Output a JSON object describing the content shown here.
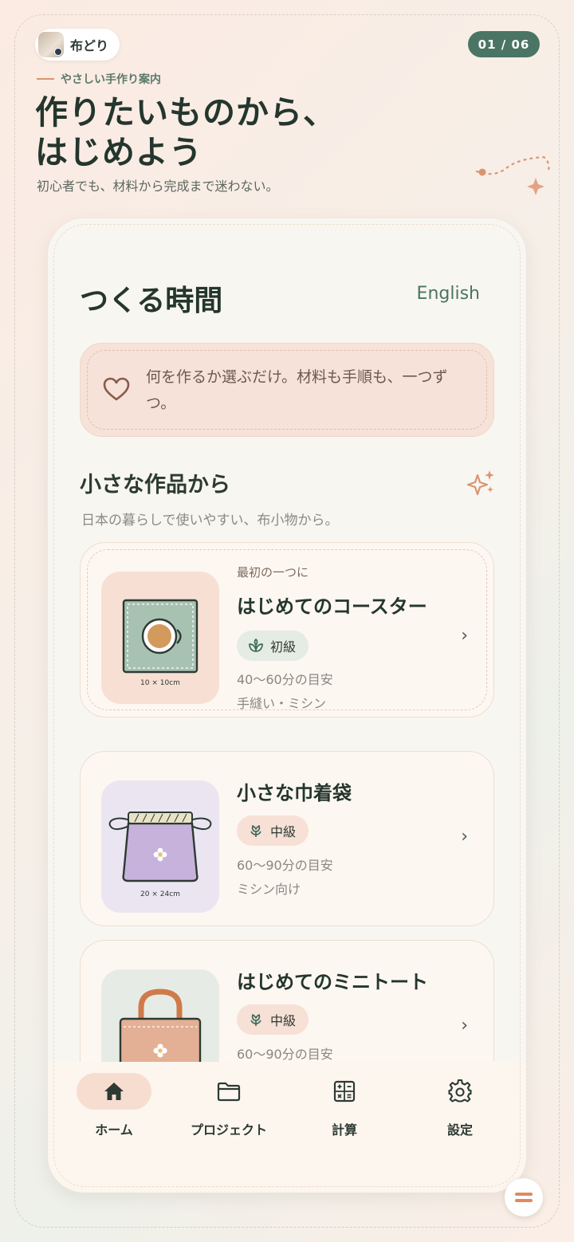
{
  "header": {
    "brand": "布どり",
    "pager": "01 / 06",
    "eyebrow": "やさしい手作り案内",
    "title_line1": "作りたいものから、",
    "title_line2": "はじめよう",
    "subtitle": "初心者でも、材料から完成まで迷わない。"
  },
  "app": {
    "title": "つくる時間",
    "language": "English",
    "notice": "何を作るか選ぶだけ。材料も手順も、一つずつ。",
    "section_title": "小さな作品から",
    "section_subtitle": "日本の暮らしで使いやすい、布小物から。"
  },
  "items": [
    {
      "kicker": "最初の一つに",
      "name": "はじめてのコースター",
      "level": "初級",
      "time": "40〜60分の目安",
      "method": "手縫い・ミシン",
      "size": "10 × 10cm",
      "tag_color": "#e4ece4"
    },
    {
      "kicker": "",
      "name": "小さな巾着袋",
      "level": "中級",
      "time": "60〜90分の目安",
      "method": "ミシン向け",
      "size": "20 × 24cm",
      "tag_color": "#f7e0d6"
    },
    {
      "kicker": "",
      "name": "はじめてのミニトート",
      "level": "中級",
      "time": "60〜90分の目安",
      "method": "",
      "size": "",
      "tag_color": "#f7e0d6"
    }
  ],
  "nav": [
    {
      "label": "ホーム",
      "icon": "home-icon",
      "active": true
    },
    {
      "label": "プロジェクト",
      "icon": "folder-icon",
      "active": false
    },
    {
      "label": "計算",
      "icon": "calculator-icon",
      "active": false
    },
    {
      "label": "設定",
      "icon": "gear-icon",
      "active": false
    }
  ],
  "colors": {
    "accent": "#4a7565",
    "peach": "#f6e2d8",
    "terracotta": "#d9956f"
  }
}
